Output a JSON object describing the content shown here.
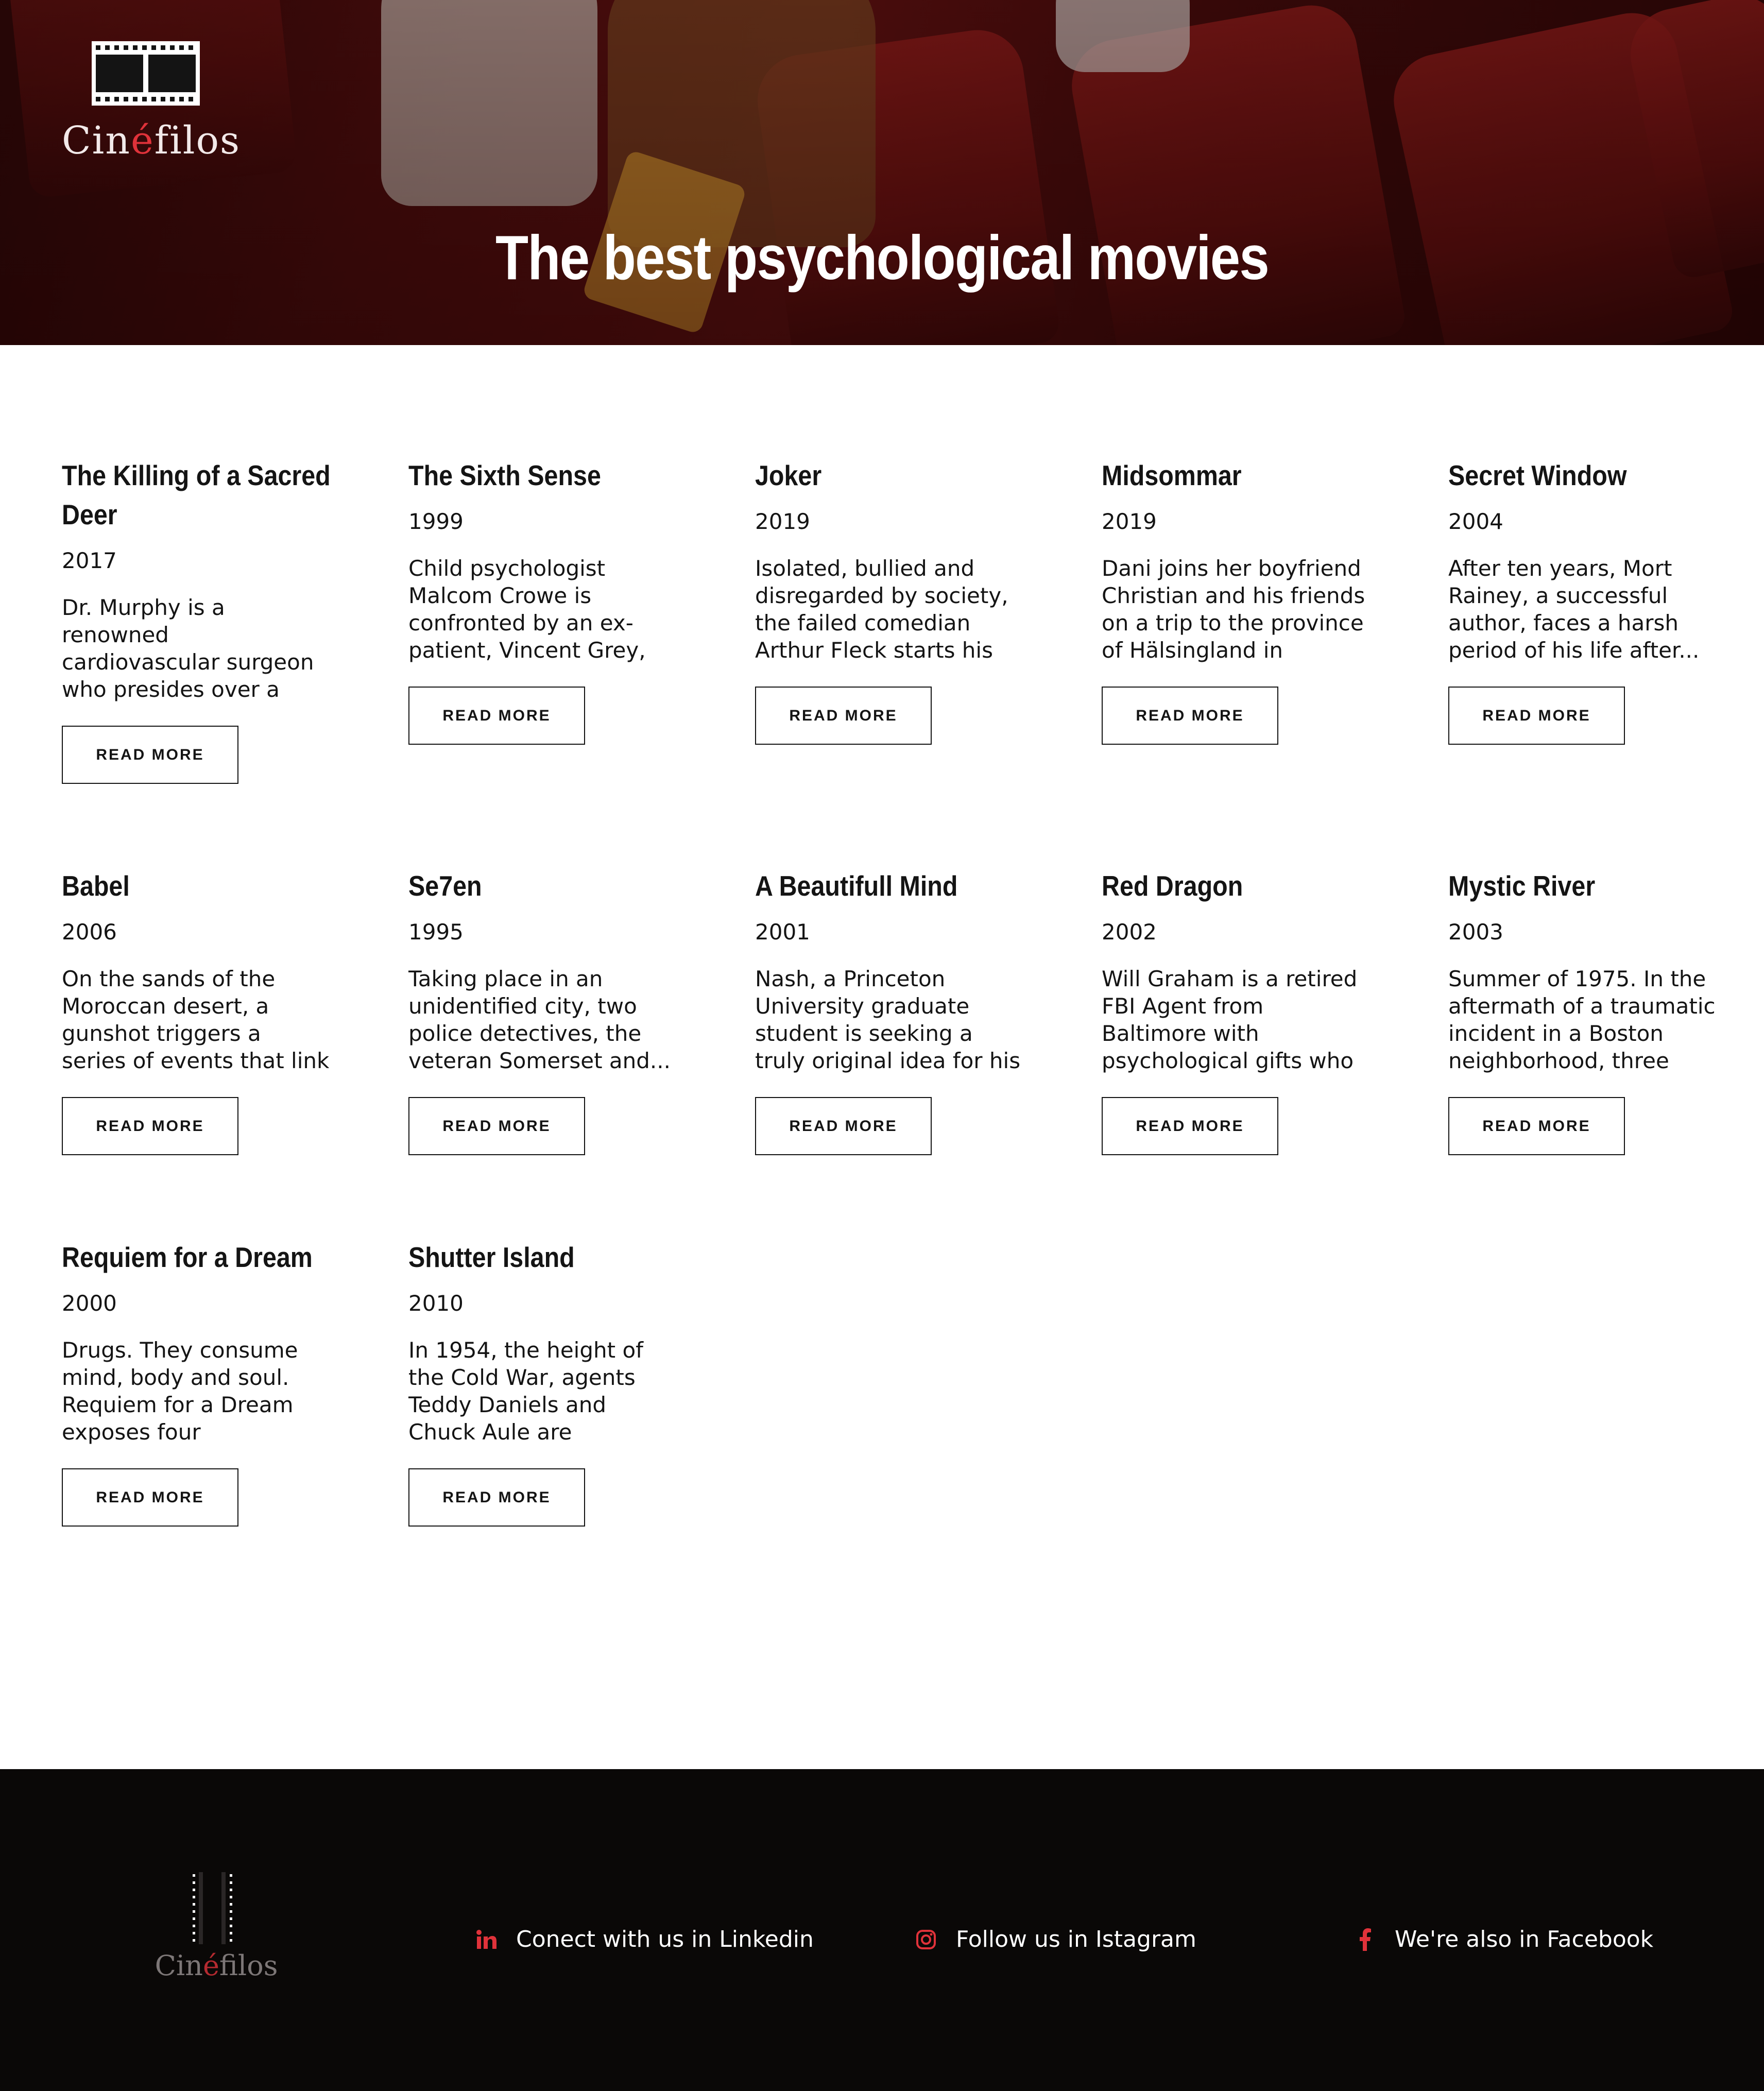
{
  "brand": {
    "name_prefix": "Cin",
    "name_accent": "é",
    "name_suffix": "filos"
  },
  "hero": {
    "title": "The best psychological movies"
  },
  "movies": [
    {
      "title": "The Killing of a Sacred Deer",
      "year": "2017",
      "description": "Dr. Murphy is a renowned cardiovascular surgeon who presides over a spotless household with...",
      "button": "READ MORE"
    },
    {
      "title": "The Sixth Sense",
      "year": "1999",
      "description": "Child psychologist Malcom Crowe is confronted by an ex-patient, Vincent Grey, who is unsatisfied,...",
      "button": "READ MORE"
    },
    {
      "title": "Joker",
      "year": "2019",
      "description": "Isolated, bullied and disregarded by society, the failed comedian Arthur Fleck starts his path as a...",
      "button": "READ MORE"
    },
    {
      "title": "Midsommar",
      "year": "2019",
      "description": "Dani joins her boyfriend Christian and his friends on a trip to the province of Hälsingland in Sweden i...",
      "button": "READ MORE"
    },
    {
      "title": "Secret Window",
      "year": "2004",
      "description": "After ten years, Mort Rainey, a successful author, faces a harsh period of his life after...",
      "button": "READ MORE"
    },
    {
      "title": "Babel",
      "year": "2006",
      "description": "On the sands of the Moroccan desert, a gunshot triggers a series of events that link a...",
      "button": "READ MORE"
    },
    {
      "title": "Se7en",
      "year": "1995",
      "description": "Taking place in an unidentified city, two police detectives, the veteran Somerset and...",
      "button": "READ MORE"
    },
    {
      "title": "A Beautifull Mind",
      "year": "2001",
      "description": "Nash, a Princeton University graduate student is seeking a truly original idea for his thesi...",
      "button": "READ MORE"
    },
    {
      "title": "Red Dragon",
      "year": "2002",
      "description": "Will Graham is a retired FBI Agent from Baltimore with psychological gifts who left the agency after...",
      "button": "READ MORE"
    },
    {
      "title": "Mystic River",
      "year": "2003",
      "description": "Summer of 1975. In the aftermath of a traumatic incident in a Boston neighborhood, three kid...",
      "button": "READ MORE"
    },
    {
      "title": "Requiem for a Dream",
      "year": "2000",
      "description": "Drugs. They consume mind, body and soul. Requiem for a Dream exposes four paralleled...",
      "button": "READ MORE"
    },
    {
      "title": "Shutter Island",
      "year": "2010",
      "description": "In 1954, the height of the Cold War, agents Teddy Daniels and Chuck Aule are summoned to \"Shutt...",
      "button": "READ MORE"
    }
  ],
  "footer": {
    "linkedin": {
      "label": "Conect with us in Linkedin",
      "icon": "linkedin-icon"
    },
    "instagram": {
      "label": "Follow us in Istagram",
      "icon": "instagram-icon"
    },
    "facebook": {
      "label": "We're also in Facebook",
      "icon": "facebook-icon"
    }
  },
  "colors": {
    "accent": "#e0323a",
    "footer_bg": "#0a0807",
    "hero_red": "#5c1111"
  }
}
